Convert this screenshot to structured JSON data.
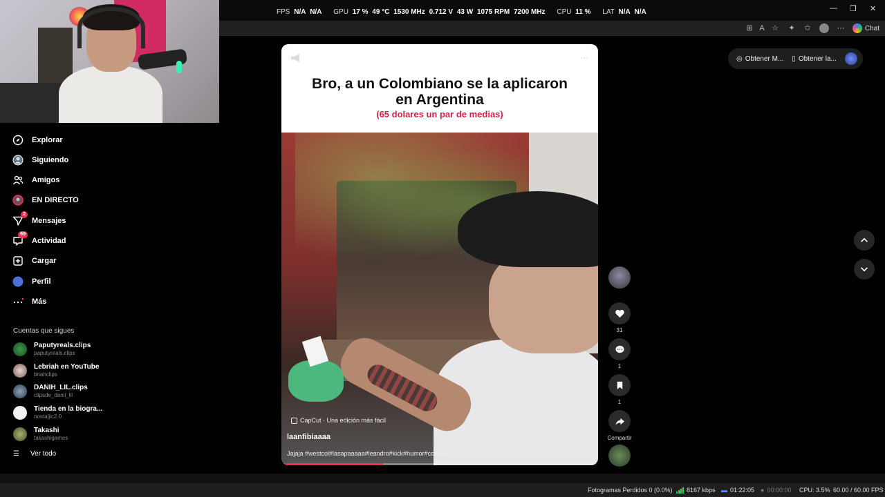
{
  "perf_overlay": {
    "fps_label": "FPS",
    "fps_value": "N/A",
    "fps_value2": "N/A",
    "gpu_label": "GPU",
    "gpu_load": "17 %",
    "gpu_temp": "49 °C",
    "gpu_clock": "1530 MHz",
    "gpu_volt": "0.712 V",
    "gpu_power": "43 W",
    "gpu_fan": "1075 RPM",
    "gpu_mem": "7200 MHz",
    "cpu_label": "CPU",
    "cpu_load": "11 %",
    "lat_label": "LAT",
    "lat_value": "N/A",
    "lat_value2": "N/A"
  },
  "browser": {
    "chat_label": "Chat"
  },
  "sidebar": {
    "items": [
      {
        "label": "Explorar",
        "icon": "compass-icon"
      },
      {
        "label": "Siguiendo",
        "icon": "following-icon"
      },
      {
        "label": "Amigos",
        "icon": "friends-icon"
      },
      {
        "label": "EN DIRECTO",
        "icon": "live-icon"
      },
      {
        "label": "Mensajes",
        "icon": "messages-icon",
        "badge": "2"
      },
      {
        "label": "Actividad",
        "icon": "activity-icon",
        "badge": "69"
      },
      {
        "label": "Cargar",
        "icon": "upload-icon"
      },
      {
        "label": "Perfil",
        "icon": "profile-icon"
      },
      {
        "label": "Más",
        "icon": "more-icon"
      }
    ],
    "following_title": "Cuentas que sigues",
    "following": [
      {
        "name": "Paputyreals.clips",
        "handle": "paputyreals.clips"
      },
      {
        "name": "Lebriah en YouTube",
        "handle": "briahclips"
      },
      {
        "name": "DANIH_LIL.clips",
        "handle": "clipsde_danii_lil"
      },
      {
        "name": "Tienda en la biogra...",
        "handle": "nostaljic2.0"
      },
      {
        "name": "Takashi",
        "handle": "takashigames"
      }
    ],
    "see_all": "Ver todo"
  },
  "video": {
    "title_line1": "Bro, a un Colombiano se la aplicaron",
    "title_line2": "en Argentina",
    "subtitle": "(65 dolares un par de medias)",
    "capcut": "CapCut · Una edición más fácil",
    "author": "laanfibiaaaa",
    "description": "Jajaja #westcol#lasapaaaaa#leandro#kick#humor#comedia",
    "progress": 0.32
  },
  "actions": {
    "likes": "31",
    "comments": "1",
    "saves": "1",
    "share_label": "Compartir"
  },
  "right_top": {
    "btn1": "Obtener M...",
    "btn2": "Obtener la..."
  },
  "statusbar": {
    "dropped": "Fotogramas Perdidos 0 (0.0%)",
    "bitrate": "8167 kbps",
    "rec_time": "01:22:05",
    "stream_time": "00:00:00",
    "cpu": "CPU: 3.5%",
    "fps": "60.00 / 60.00 FPS"
  },
  "colors": {
    "accent": "#fe2c55",
    "background": "#000000"
  }
}
